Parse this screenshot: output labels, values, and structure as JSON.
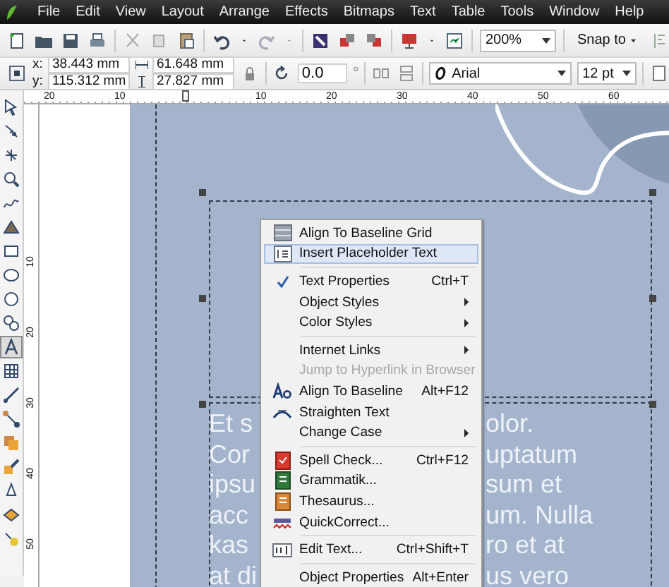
{
  "menubar": [
    "File",
    "Edit",
    "View",
    "Layout",
    "Arrange",
    "Effects",
    "Bitmaps",
    "Text",
    "Table",
    "Tools",
    "Window",
    "Help"
  ],
  "toolbar": {
    "zoom": "200%",
    "snap": "Snap to"
  },
  "property_bar": {
    "x_label": "x:",
    "x": "38.443 mm",
    "y_label": "y:",
    "y": "115.312 mm",
    "width": "61.648 mm",
    "height": "27.827 mm",
    "rotation": "0.0",
    "degree": "°",
    "font": "Arial",
    "font_size": "12 pt"
  },
  "ruler": {
    "left_of_origin": [
      "20",
      "10"
    ],
    "right_of_origin": [
      "10",
      "20",
      "30",
      "40",
      "50",
      "60"
    ],
    "vertical": [
      "10",
      "20",
      "30",
      "40",
      "50"
    ]
  },
  "toolbox": [
    {
      "selected": false
    },
    {
      "selected": false
    },
    {
      "selected": false
    },
    {
      "selected": false
    },
    {
      "selected": false
    },
    {
      "selected": false
    },
    {
      "selected": false
    },
    {
      "selected": false
    },
    {
      "selected": false
    },
    {
      "selected": false
    },
    {
      "selected": true
    },
    {
      "selected": false
    },
    {
      "selected": false
    },
    {
      "selected": false
    },
    {
      "selected": false
    },
    {
      "selected": false
    },
    {
      "selected": false
    },
    {
      "selected": false
    },
    {
      "selected": false
    }
  ],
  "canvas_text": [
    {
      "left": "Et s",
      "right": "olor."
    },
    {
      "left": "Cor",
      "right": "uptatum"
    },
    {
      "left": "ipsu",
      "right": "sum et"
    },
    {
      "left": "acc",
      "right": "um. Nulla"
    },
    {
      "left": "kas",
      "right": "ro et at"
    },
    {
      "left": "at di",
      "right": "us vero"
    }
  ],
  "context_menu": [
    {
      "kind": "item",
      "label": "Align To Baseline Grid",
      "selected": false,
      "disabled": false,
      "checked": false,
      "submenu": false
    },
    {
      "kind": "item",
      "label": "Insert Placeholder Text",
      "selected": true,
      "disabled": false,
      "checked": false,
      "submenu": false
    },
    {
      "kind": "separator"
    },
    {
      "kind": "item",
      "label": "Text Properties",
      "shortcut": "Ctrl+T",
      "selected": false,
      "disabled": false,
      "checked": true,
      "submenu": false
    },
    {
      "kind": "item",
      "label": "Object Styles",
      "selected": false,
      "disabled": false,
      "checked": false,
      "submenu": true
    },
    {
      "kind": "item",
      "label": "Color Styles",
      "selected": false,
      "disabled": false,
      "checked": false,
      "submenu": true
    },
    {
      "kind": "separator"
    },
    {
      "kind": "item",
      "label": "Internet Links",
      "selected": false,
      "disabled": false,
      "checked": false,
      "submenu": true
    },
    {
      "kind": "item",
      "label": "Jump to Hyperlink in Browser",
      "selected": false,
      "disabled": true,
      "checked": false,
      "submenu": false
    },
    {
      "kind": "item",
      "label": "Align To Baseline",
      "shortcut": "Alt+F12",
      "selected": false,
      "disabled": false,
      "checked": false,
      "submenu": false
    },
    {
      "kind": "item",
      "label": "Straighten Text",
      "selected": false,
      "disabled": false,
      "checked": false,
      "submenu": false
    },
    {
      "kind": "item",
      "label": "Change Case",
      "selected": false,
      "disabled": false,
      "checked": false,
      "submenu": true
    },
    {
      "kind": "separator"
    },
    {
      "kind": "item",
      "label": "Spell Check...",
      "shortcut": "Ctrl+F12",
      "selected": false,
      "disabled": false,
      "checked": false,
      "submenu": false
    },
    {
      "kind": "item",
      "label": "Grammatik...",
      "selected": false,
      "disabled": false,
      "checked": false,
      "submenu": false
    },
    {
      "kind": "item",
      "label": "Thesaurus...",
      "selected": false,
      "disabled": false,
      "checked": false,
      "submenu": false
    },
    {
      "kind": "item",
      "label": "QuickCorrect...",
      "selected": false,
      "disabled": false,
      "checked": false,
      "submenu": false
    },
    {
      "kind": "separator"
    },
    {
      "kind": "item",
      "label": "Edit Text...",
      "shortcut": "Ctrl+Shift+T",
      "selected": false,
      "disabled": false,
      "checked": false,
      "submenu": false
    },
    {
      "kind": "separator"
    },
    {
      "kind": "item",
      "label": "Object Properties",
      "shortcut": "Alt+Enter",
      "selected": false,
      "disabled": false,
      "checked": false,
      "submenu": false
    }
  ]
}
